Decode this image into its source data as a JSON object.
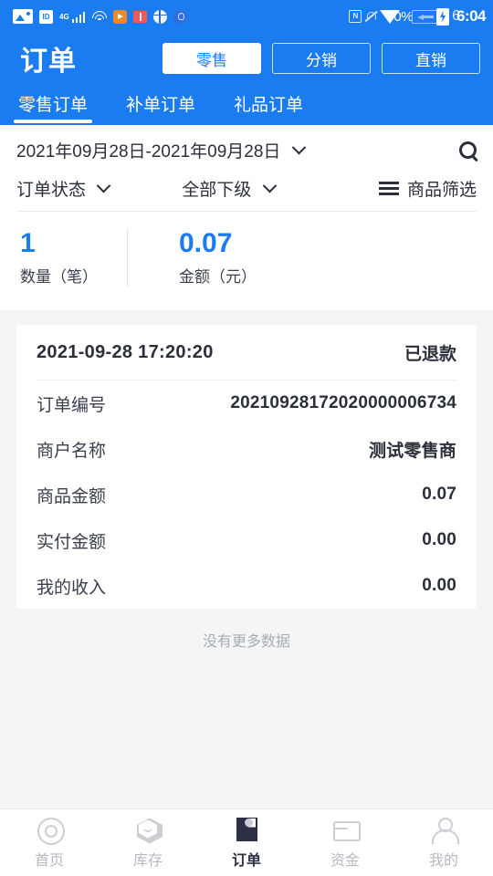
{
  "statusbar": {
    "icons_left": [
      "photo-icon",
      "id-icon",
      "4g-icon",
      "signal-icon",
      "wifi-icon",
      "play-icon",
      "book-icon",
      "globe-icon",
      "bulb-icon"
    ],
    "label_4g": "4G",
    "id_text": "ID",
    "nfc_text": "N",
    "battery_percent": "0%",
    "time_ghost": "6",
    "time": "6:04"
  },
  "header": {
    "title": "订单",
    "segments": [
      {
        "label": "零售",
        "active": true
      },
      {
        "label": "分销",
        "active": false
      },
      {
        "label": "直销",
        "active": false
      }
    ],
    "tabs": [
      {
        "label": "零售订单",
        "active": true
      },
      {
        "label": "补单订单",
        "active": false
      },
      {
        "label": "礼品订单",
        "active": false
      }
    ]
  },
  "filters": {
    "date_range": "2021年09月28日-2021年09月28日",
    "order_status": "订单状态",
    "subordinate": "全部下级",
    "goods_filter": "商品筛选"
  },
  "summary": {
    "count_value": "1",
    "count_label": "数量（笔）",
    "amount_value": "0.07",
    "amount_label": "金额（元）"
  },
  "order": {
    "datetime": "2021-09-28  17:20:20",
    "status": "已退款",
    "rows": [
      {
        "label": "订单编号",
        "value": "20210928172020000006734"
      },
      {
        "label": "商户名称",
        "value": "测试零售商"
      },
      {
        "label": "商品金额",
        "value": "0.07"
      },
      {
        "label": "实付金额",
        "value": "0.00"
      },
      {
        "label": "我的收入",
        "value": "0.00"
      }
    ]
  },
  "list_footer": "没有更多数据",
  "bottom_nav": [
    {
      "label": "首页",
      "active": false
    },
    {
      "label": "库存",
      "active": false
    },
    {
      "label": "订单",
      "active": true
    },
    {
      "label": "资金",
      "active": false
    },
    {
      "label": "我的",
      "active": false
    }
  ],
  "colors": {
    "brand_blue": "#1a7cf0",
    "page_bg": "#f4f5f7",
    "text_dark": "#2b2f3a",
    "nav_inactive": "#b6b9c0"
  }
}
